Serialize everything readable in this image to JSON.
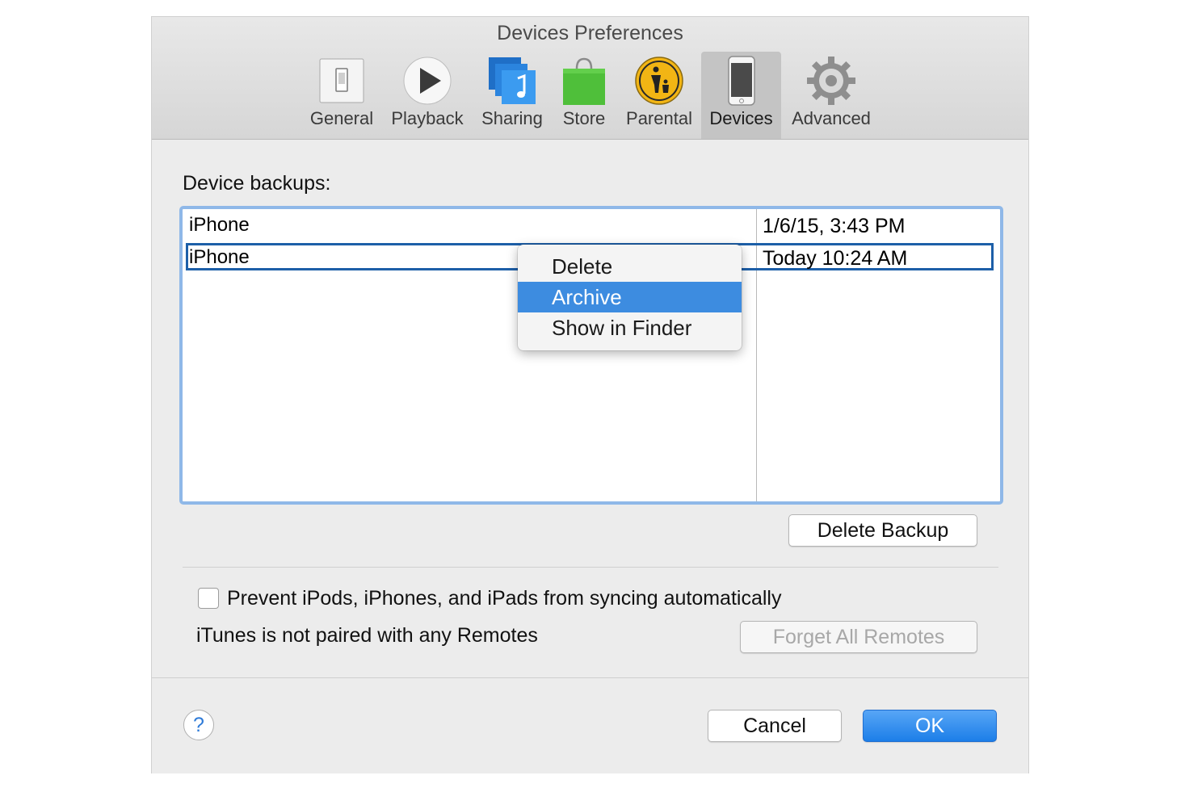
{
  "window": {
    "title": "Devices Preferences"
  },
  "toolbar": {
    "tabs": [
      {
        "label": "General",
        "icon": "switch-icon"
      },
      {
        "label": "Playback",
        "icon": "play-icon"
      },
      {
        "label": "Sharing",
        "icon": "music-share-icon"
      },
      {
        "label": "Store",
        "icon": "shopping-bag-icon"
      },
      {
        "label": "Parental",
        "icon": "parental-icon"
      },
      {
        "label": "Devices",
        "icon": "iphone-icon",
        "selected": true
      },
      {
        "label": "Advanced",
        "icon": "gear-icon"
      }
    ]
  },
  "backups": {
    "label": "Device backups:",
    "rows": [
      {
        "name": "iPhone",
        "date": "1/6/15, 3:43 PM"
      },
      {
        "name": "iPhone",
        "date": "Today 10:24 AM",
        "selected": true
      }
    ]
  },
  "context_menu": {
    "items": [
      {
        "label": "Delete"
      },
      {
        "label": "Archive",
        "highlighted": true
      },
      {
        "label": "Show in Finder"
      }
    ]
  },
  "buttons": {
    "delete_backup": "Delete Backup",
    "forget_remotes": "Forget All Remotes",
    "cancel": "Cancel",
    "ok": "OK",
    "help": "?"
  },
  "options": {
    "prevent_sync_label": "Prevent iPods, iPhones, and iPads from syncing automatically",
    "prevent_sync_checked": false,
    "remotes_status": "iTunes is not paired with any Remotes"
  },
  "colors": {
    "accent": "#3d8ce0",
    "list_focus_ring": "#8fb8e8",
    "selection_border": "#1d5fa8",
    "ok_button": "#1c7ee8"
  }
}
